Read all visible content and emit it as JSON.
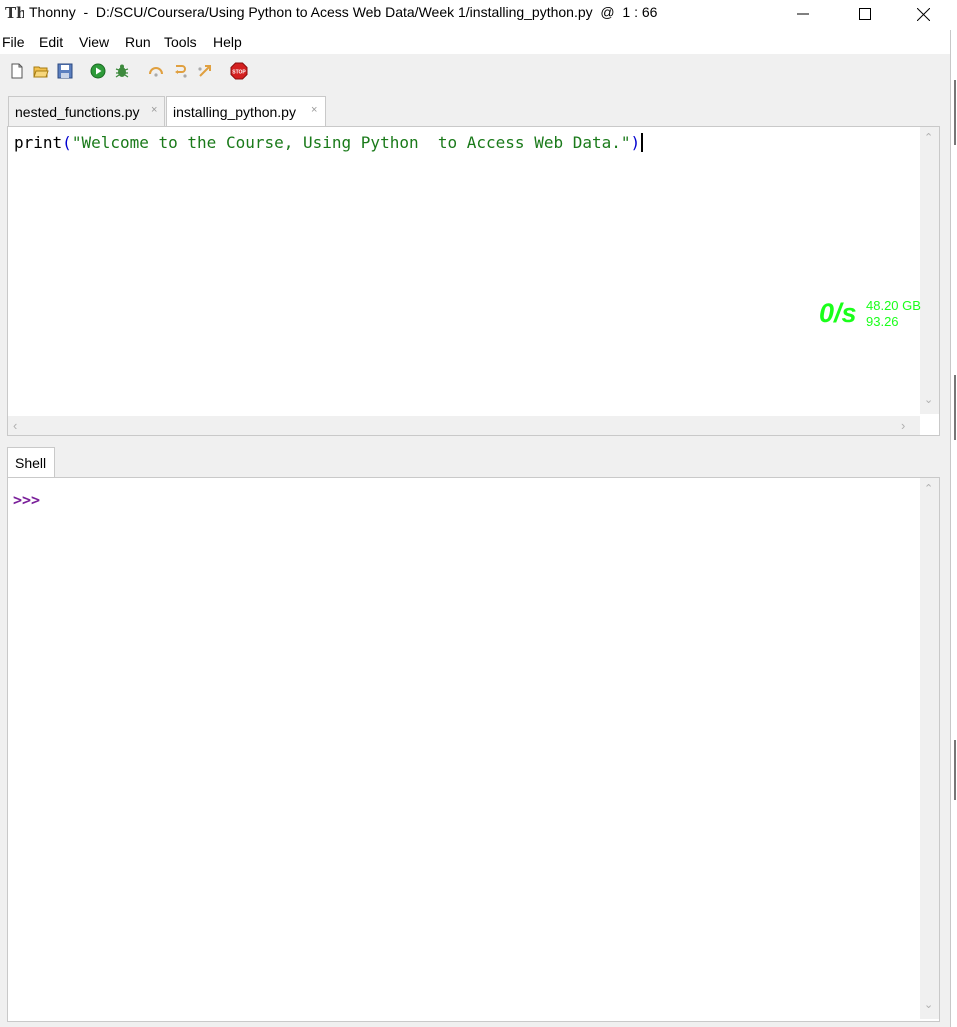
{
  "window": {
    "title": "Thonny  -  D:/SCU/Coursera/Using Python to Acess Web Data/Week 1/installing_python.py  @  1 : 66",
    "logo_text": "Th"
  },
  "menu": [
    "File",
    "Edit",
    "View",
    "Run",
    "Tools",
    "Help"
  ],
  "toolbar": {
    "icons": [
      "new-file-icon",
      "open-file-icon",
      "save-icon",
      "run-icon",
      "debug-icon",
      "step-over-icon",
      "step-into-icon",
      "step-out-icon",
      "stop-icon"
    ],
    "stop_label": "STOP"
  },
  "editor": {
    "tabs": [
      {
        "label": "nested_functions.py",
        "close": "×"
      },
      {
        "label": "installing_python.py",
        "close": "×"
      }
    ],
    "active_tab": "installing_python.py",
    "code": {
      "func": "print",
      "open_paren": "(",
      "string": "\"Welcome to the Course, Using Python  to Access Web Data.\"",
      "close_paren": ")"
    }
  },
  "overlay": {
    "speed": "0/s",
    "line1": "48.20 GB",
    "line2": "93.26"
  },
  "shell": {
    "tab_label": "Shell",
    "prompt": ">>>"
  },
  "colors": {
    "string": "#1a7a1a",
    "paren": "#0000d0",
    "prompt": "#7a1f9a",
    "overlay": "#1aff1a",
    "stop": "#d42020"
  }
}
